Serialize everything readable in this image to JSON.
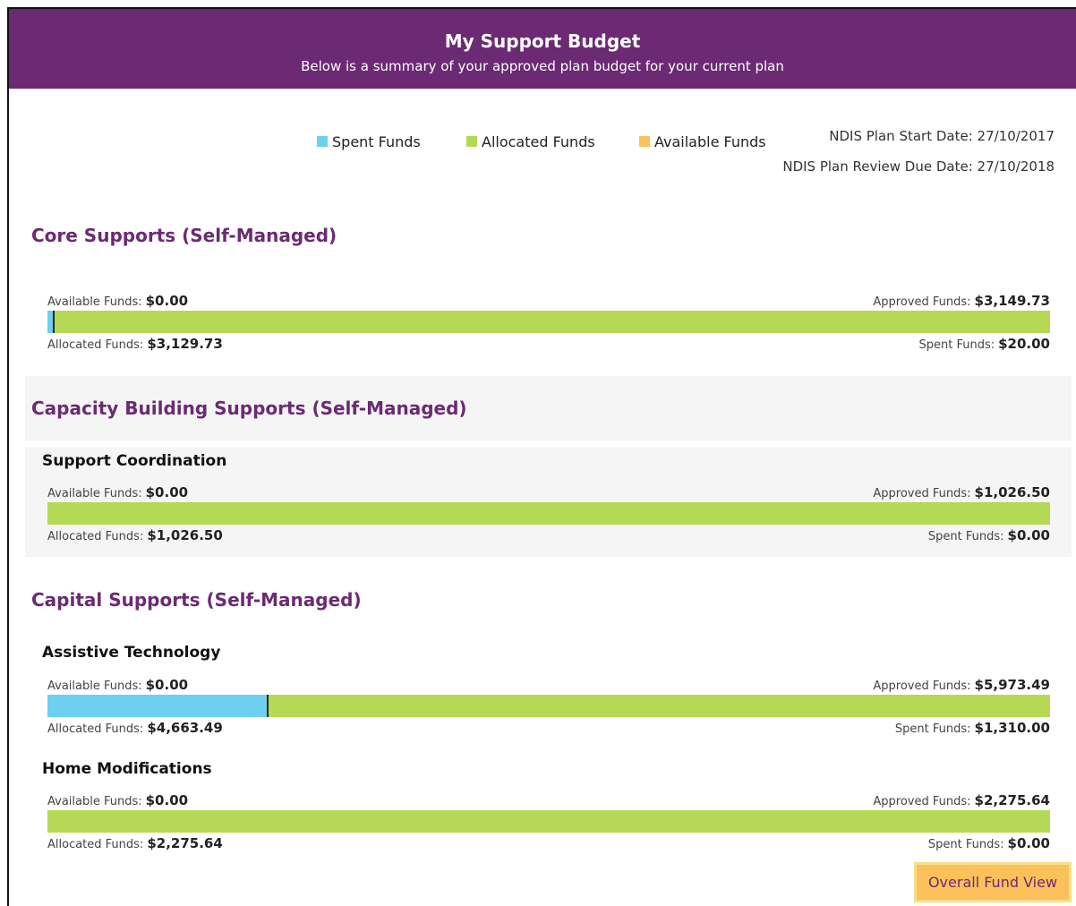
{
  "header": {
    "title": "My Support Budget",
    "subtitle": "Below is a summary of your approved plan budget for your current plan"
  },
  "legend": [
    {
      "label": "Spent Funds",
      "color": "#6dd0f0"
    },
    {
      "label": "Allocated Funds",
      "color": "#b5d955"
    },
    {
      "label": "Available Funds",
      "color": "#fcc15a"
    }
  ],
  "plan": {
    "start": "NDIS Plan Start Date: 27/10/2017",
    "review": "NDIS Plan Review Due Date: 27/10/2018"
  },
  "field_labels": {
    "available": "Available Funds:",
    "approved": "Approved Funds:",
    "allocated": "Allocated Funds:",
    "spent": "Spent Funds:"
  },
  "categories": [
    {
      "title": "Core Supports (Self-Managed)",
      "items": [
        {
          "name": "",
          "available": "$0.00",
          "approved": "$3,149.73",
          "allocated": "$3,129.73",
          "spent": "$20.00",
          "spent_fraction": 0.0064
        }
      ]
    },
    {
      "title": "Capacity Building Supports (Self-Managed)",
      "items": [
        {
          "name": "Support Coordination",
          "available": "$0.00",
          "approved": "$1,026.50",
          "allocated": "$1,026.50",
          "spent": "$0.00",
          "spent_fraction": 0
        }
      ]
    },
    {
      "title": "Capital Supports (Self-Managed)",
      "items": [
        {
          "name": "Assistive Technology",
          "available": "$0.00",
          "approved": "$5,973.49",
          "allocated": "$4,663.49",
          "spent": "$1,310.00",
          "spent_fraction": 0.2193
        },
        {
          "name": "Home Modifications",
          "available": "$0.00",
          "approved": "$2,275.64",
          "allocated": "$2,275.64",
          "spent": "$0.00",
          "spent_fraction": 0
        }
      ]
    }
  ],
  "button": {
    "label": "Overall Fund View"
  },
  "colors": {
    "brand": "#6b2a73",
    "spent": "#6dd0f0",
    "allocated": "#b5d955",
    "available": "#fcc15a"
  }
}
